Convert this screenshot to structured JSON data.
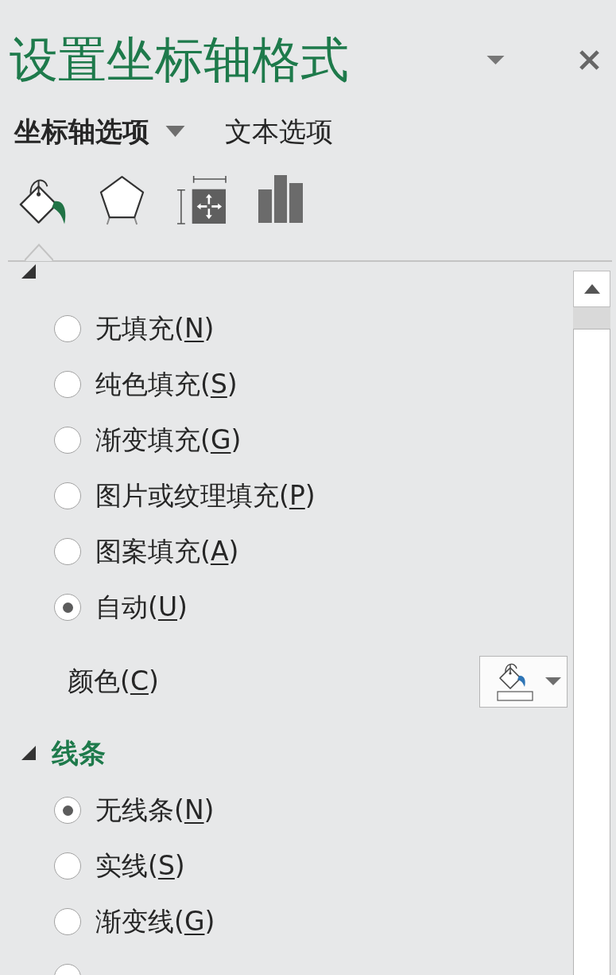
{
  "pane": {
    "title": "设置坐标轴格式"
  },
  "tabs": [
    {
      "label": "坐标轴选项",
      "selected": true,
      "dropdown": true
    },
    {
      "label": "文本选项",
      "selected": false,
      "dropdown": false
    }
  ],
  "categories": [
    {
      "kind": "fill",
      "selected": true
    },
    {
      "kind": "effects",
      "selected": false
    },
    {
      "kind": "size",
      "selected": false
    },
    {
      "kind": "axis",
      "selected": false
    }
  ],
  "sections": [
    {
      "expanded": true,
      "options": [
        {
          "label": "无填充(",
          "access_key": "N",
          "label_end": ")",
          "selected": false
        },
        {
          "label": "纯色填充(",
          "access_key": "S",
          "label_end": ")",
          "selected": false
        },
        {
          "label": "渐变填充(",
          "access_key": "G",
          "label_end": ")",
          "selected": false
        },
        {
          "label": "图片或纹理填充(",
          "access_key": "P",
          "label_end": ")",
          "selected": false
        },
        {
          "label": "图案填充(",
          "access_key": "A",
          "label_end": ")",
          "selected": false
        },
        {
          "label": "自动(",
          "access_key": "U",
          "label_end": ")",
          "selected": true
        }
      ],
      "color_setting": {
        "label": "颜色(",
        "access_key": "C",
        "label_end": ")"
      }
    },
    {
      "title": "线条",
      "expanded": true,
      "options": [
        {
          "label": "无线条(",
          "access_key": "N",
          "label_end": ")",
          "selected": true
        },
        {
          "label": "实线(",
          "access_key": "S",
          "label_end": ")",
          "selected": false
        },
        {
          "label": "渐变线(",
          "access_key": "G",
          "label_end": ")",
          "selected": false
        },
        {
          "selected": false
        }
      ]
    }
  ]
}
